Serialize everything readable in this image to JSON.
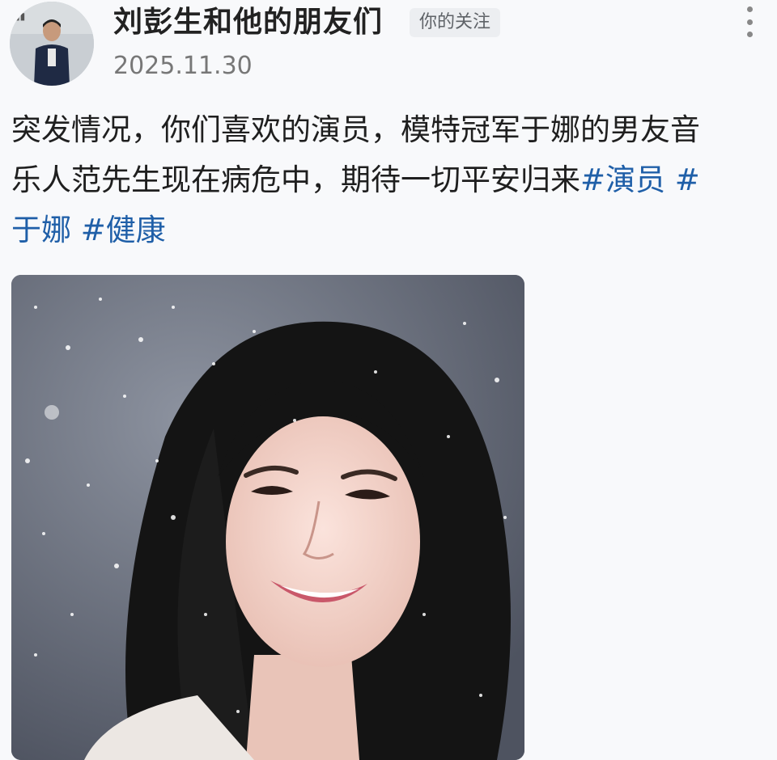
{
  "post": {
    "author_name": "刘彭生和他的朋友们",
    "follow_badge": "你的关注",
    "date": "2025.11.30",
    "body": {
      "line1": "突发情况，你们喜欢的演员，模特冠军于娜的男友音",
      "line2_text": "乐人范先生现在病危中，期待一切平安归来",
      "line2_tag1": "#演员",
      "line2_tag2": " #",
      "line3_tag2_cont": "于娜",
      "line3_tag3": " #健康"
    },
    "image": {
      "subject": "portrait photo of smiling woman with long black hair on snowy gray backdrop"
    }
  },
  "icons": {
    "more": "more-vertical-icon",
    "avatar": "user-avatar-photo"
  },
  "colors": {
    "hashtag": "#1f5fa8",
    "text": "#1f1f1f",
    "meta": "#777777",
    "background": "#f8f9fb"
  }
}
